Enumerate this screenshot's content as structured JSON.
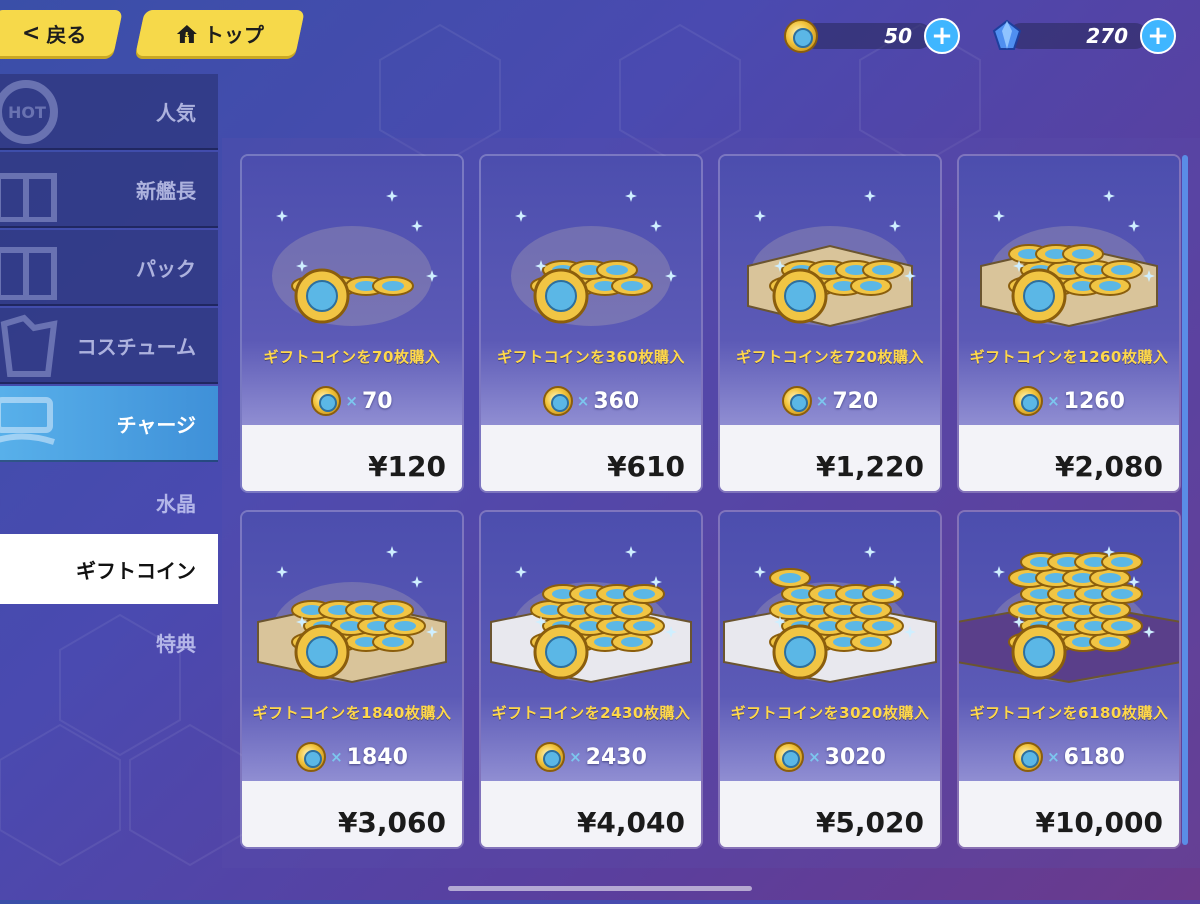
{
  "header": {
    "back_label": "戻る",
    "home_label": "トップ",
    "gift_coins": "50",
    "crystals": "270"
  },
  "sidebar": {
    "items": [
      {
        "label": "人気",
        "state": "normal"
      },
      {
        "label": "新艦長",
        "state": "normal"
      },
      {
        "label": "パック",
        "state": "normal"
      },
      {
        "label": "コスチューム",
        "state": "normal"
      },
      {
        "label": "チャージ",
        "state": "active"
      },
      {
        "label": "水晶",
        "state": "plain"
      },
      {
        "label": "ギフトコイン",
        "state": "selected"
      },
      {
        "label": "特典",
        "state": "plain"
      }
    ],
    "hot_badge": "HOT"
  },
  "products": [
    {
      "title": "ギフトコインを70枚購入",
      "x": "×",
      "amount": "70",
      "price": "¥120"
    },
    {
      "title": "ギフトコインを360枚購入",
      "x": "×",
      "amount": "360",
      "price": "¥610"
    },
    {
      "title": "ギフトコインを720枚購入",
      "x": "×",
      "amount": "720",
      "price": "¥1,220"
    },
    {
      "title": "ギフトコインを1260枚購入",
      "x": "×",
      "amount": "1260",
      "price": "¥2,080"
    },
    {
      "title": "ギフトコインを1840枚購入",
      "x": "×",
      "amount": "1840",
      "price": "¥3,060"
    },
    {
      "title": "ギフトコインを2430枚購入",
      "x": "×",
      "amount": "2430",
      "price": "¥4,040"
    },
    {
      "title": "ギフトコインを3020枚購入",
      "x": "×",
      "amount": "3020",
      "price": "¥5,020"
    },
    {
      "title": "ギフトコインを6180枚購入",
      "x": "×",
      "amount": "6180",
      "price": "¥10,000"
    }
  ],
  "colors": {
    "accent_yellow": "#f6d94a",
    "plus_blue": "#3fb6ff",
    "title_gold": "#ffd84a"
  }
}
